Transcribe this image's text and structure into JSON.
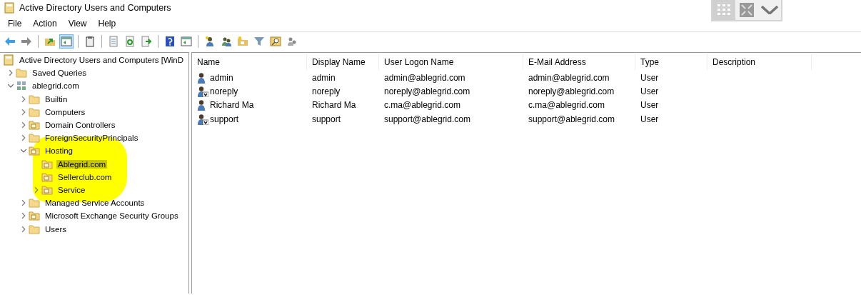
{
  "window": {
    "title": "Active Directory Users and Computers"
  },
  "menu": [
    "File",
    "Action",
    "View",
    "Help"
  ],
  "toolbar": [
    {
      "buttons": [
        {
          "kind": "back",
          "selected": false
        },
        {
          "kind": "forward",
          "selected": false
        }
      ]
    },
    {
      "buttons": [
        {
          "kind": "up",
          "selected": false
        },
        {
          "kind": "pane",
          "selected": true
        }
      ]
    },
    {
      "buttons": [
        {
          "kind": "clipboard",
          "selected": false
        }
      ]
    },
    {
      "buttons": [
        {
          "kind": "properties",
          "selected": false
        },
        {
          "kind": "refresh",
          "selected": false
        },
        {
          "kind": "export",
          "selected": false
        }
      ]
    },
    {
      "buttons": [
        {
          "kind": "help",
          "selected": false
        },
        {
          "kind": "pane",
          "selected": false
        }
      ]
    },
    {
      "buttons": [
        {
          "kind": "new-user",
          "selected": false
        },
        {
          "kind": "new-group",
          "selected": false
        },
        {
          "kind": "new-ou",
          "selected": false
        },
        {
          "kind": "filter",
          "selected": false
        },
        {
          "kind": "find",
          "selected": false
        },
        {
          "kind": "users",
          "selected": false
        }
      ]
    }
  ],
  "tree": [
    {
      "label": "Active Directory Users and Computers [WinD",
      "kind": "root",
      "selected": false,
      "children": [
        {
          "label": "Saved Queries",
          "kind": "folder",
          "expanded": false,
          "selected": false
        },
        {
          "label": "ablegrid.com",
          "kind": "domain",
          "expanded": true,
          "selected": false,
          "children": [
            {
              "label": "Builtin",
              "kind": "folder",
              "expanded": false,
              "selected": false
            },
            {
              "label": "Computers",
              "kind": "folder",
              "expanded": false,
              "selected": false
            },
            {
              "label": "Domain Controllers",
              "kind": "ou",
              "expanded": false,
              "selected": false
            },
            {
              "label": "ForeignSecurityPrincipals",
              "kind": "folder",
              "expanded": false,
              "selected": false
            },
            {
              "label": "Hosting",
              "kind": "ou",
              "expanded": true,
              "selected": false,
              "children": [
                {
                  "label": "Ablegrid.com",
                  "kind": "ou",
                  "selected": true
                },
                {
                  "label": "Sellerclub.com",
                  "kind": "ou",
                  "selected": false
                },
                {
                  "label": "Service",
                  "kind": "ou",
                  "expanded": false,
                  "selected": false
                }
              ]
            },
            {
              "label": "Managed Service Accounts",
              "kind": "folder",
              "expanded": false,
              "selected": false
            },
            {
              "label": "Microsoft Exchange Security Groups",
              "kind": "ou",
              "expanded": false,
              "selected": false
            },
            {
              "label": "Users",
              "kind": "folder",
              "expanded": false,
              "selected": false
            }
          ]
        }
      ]
    }
  ],
  "table": {
    "columns": [
      "Name",
      "Display Name",
      "User Logon Name",
      "E-Mail Address",
      "Type",
      "Description"
    ],
    "rows": [
      {
        "disabled": false,
        "cells": [
          "admin",
          "admin",
          "admin@ablegrid.com",
          "admin@ablegrid.com",
          "User"
        ]
      },
      {
        "disabled": true,
        "cells": [
          "noreply",
          "noreply",
          "noreply@ablegrid.com",
          "noreply@ablegrid.com",
          "User"
        ]
      },
      {
        "disabled": false,
        "cells": [
          "Richard Ma",
          "Richard Ma",
          "c.ma@ablegrid.com",
          "c.ma@ablegrid.com",
          "User"
        ]
      },
      {
        "disabled": true,
        "cells": [
          "support",
          "support",
          "support@ablegrid.com",
          "support@ablegrid.com",
          "User"
        ]
      }
    ]
  }
}
